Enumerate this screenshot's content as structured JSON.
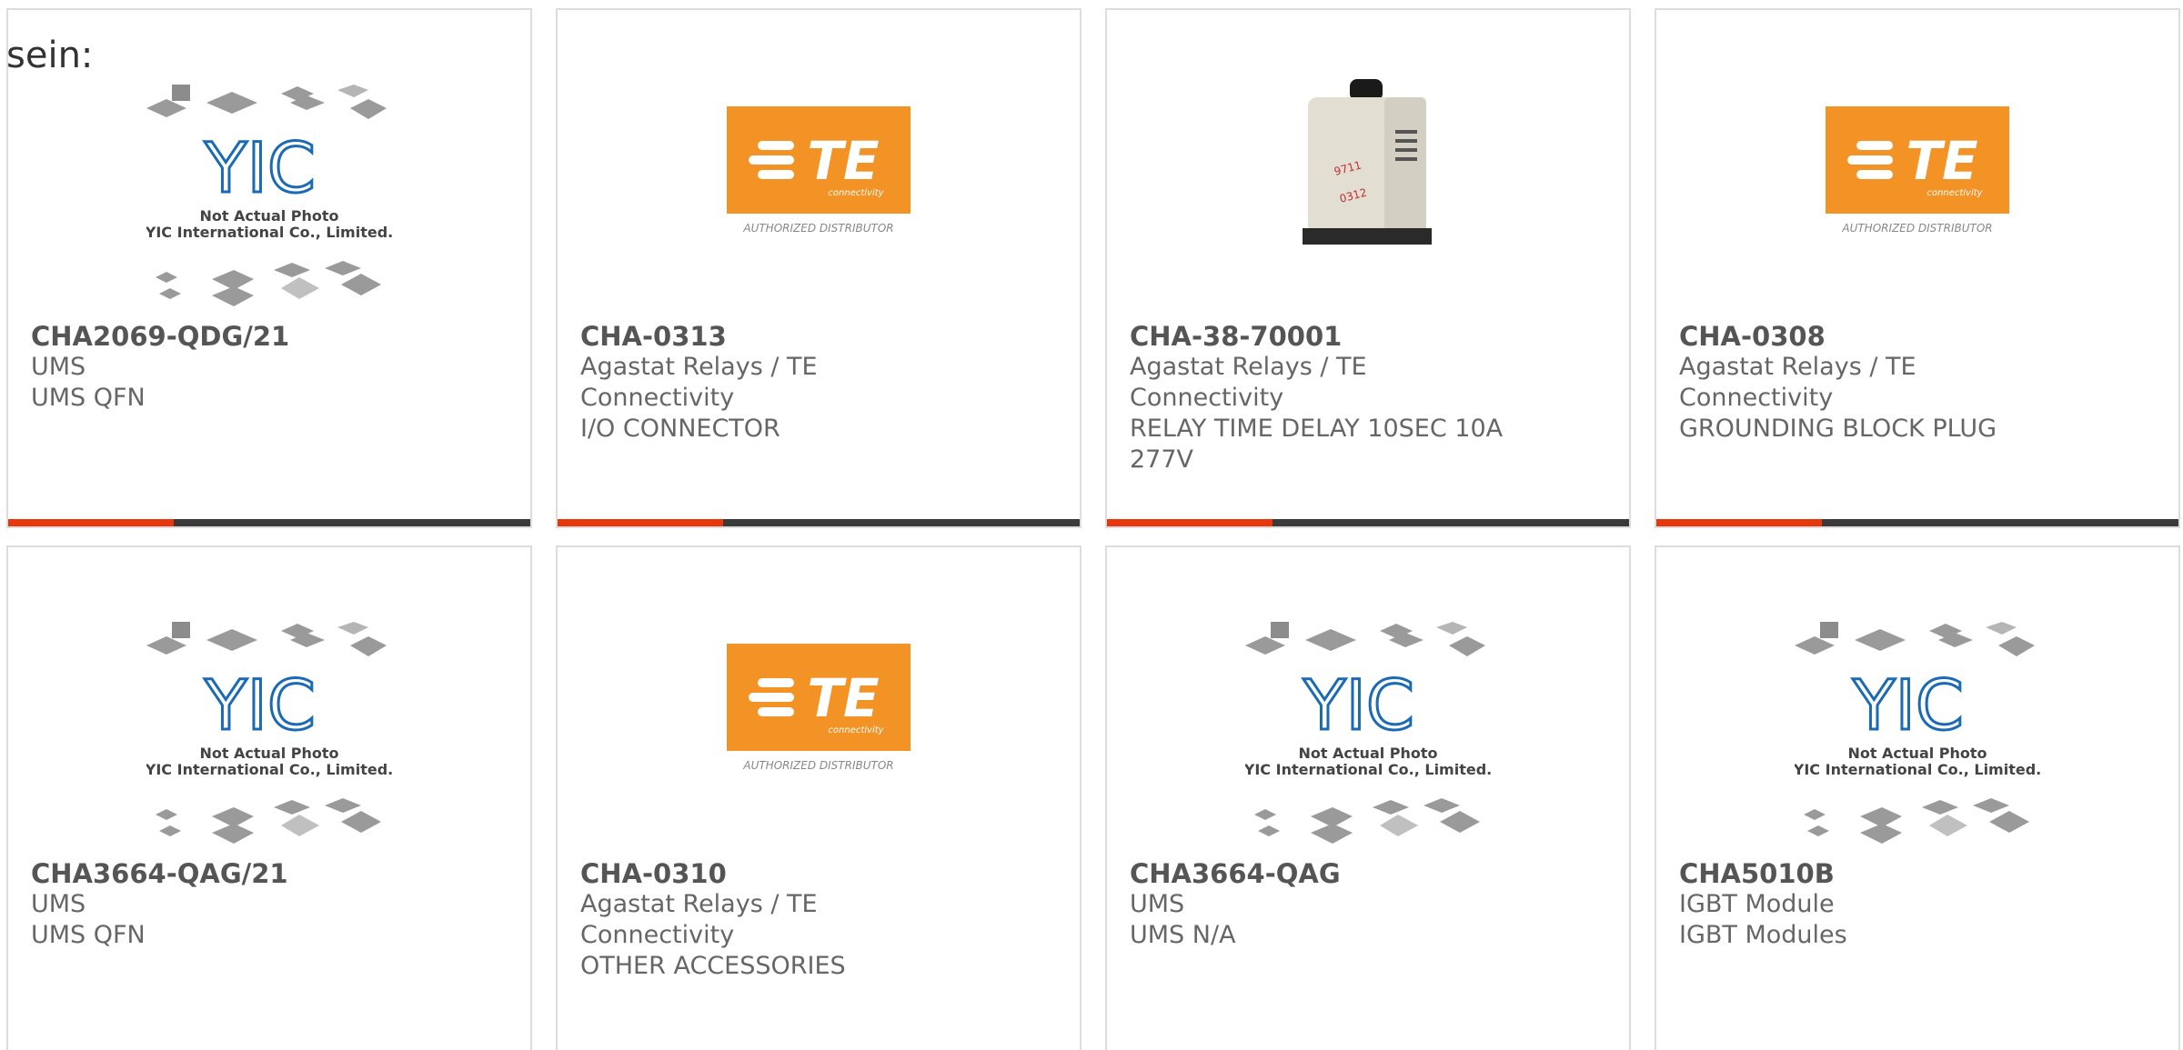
{
  "intro_text": "sein:",
  "placeholder": {
    "line1": "Not Actual Photo",
    "line2": "YIC International Co., Limited.",
    "logo": "YIC"
  },
  "te_logo": {
    "brand": "TE",
    "sub": "connectivity",
    "caption": "AUTHORIZED DISTRIBUTOR",
    "color": "#f39325"
  },
  "accent_color": "#e8370d",
  "products": [
    {
      "part": "CHA2069-QDG/21",
      "manufacturer": "UMS",
      "description": "UMS QFN",
      "image": "yic-placeholder"
    },
    {
      "part": "CHA-0313",
      "manufacturer": "Agastat Relays / TE Connectivity",
      "description": "I/O CONNECTOR",
      "image": "te-logo"
    },
    {
      "part": "CHA-38-70001",
      "manufacturer": "Agastat Relays / TE Connectivity",
      "description": "RELAY TIME DELAY 10SEC 10A 277V",
      "image": "relay-photo"
    },
    {
      "part": "CHA-0308",
      "manufacturer": "Agastat Relays / TE Connectivity",
      "description": "GROUNDING BLOCK PLUG",
      "image": "te-logo"
    },
    {
      "part": "CHA3664-QAG/21",
      "manufacturer": "UMS",
      "description": "UMS QFN",
      "image": "yic-placeholder"
    },
    {
      "part": "CHA-0310",
      "manufacturer": "Agastat Relays / TE Connectivity",
      "description": "OTHER ACCESSORIES",
      "image": "te-logo"
    },
    {
      "part": "CHA3664-QAG",
      "manufacturer": "UMS",
      "description": "UMS N/A",
      "image": "yic-placeholder"
    },
    {
      "part": "CHA5010B",
      "manufacturer": "IGBT Module",
      "description": "IGBT Modules",
      "image": "yic-placeholder"
    }
  ]
}
